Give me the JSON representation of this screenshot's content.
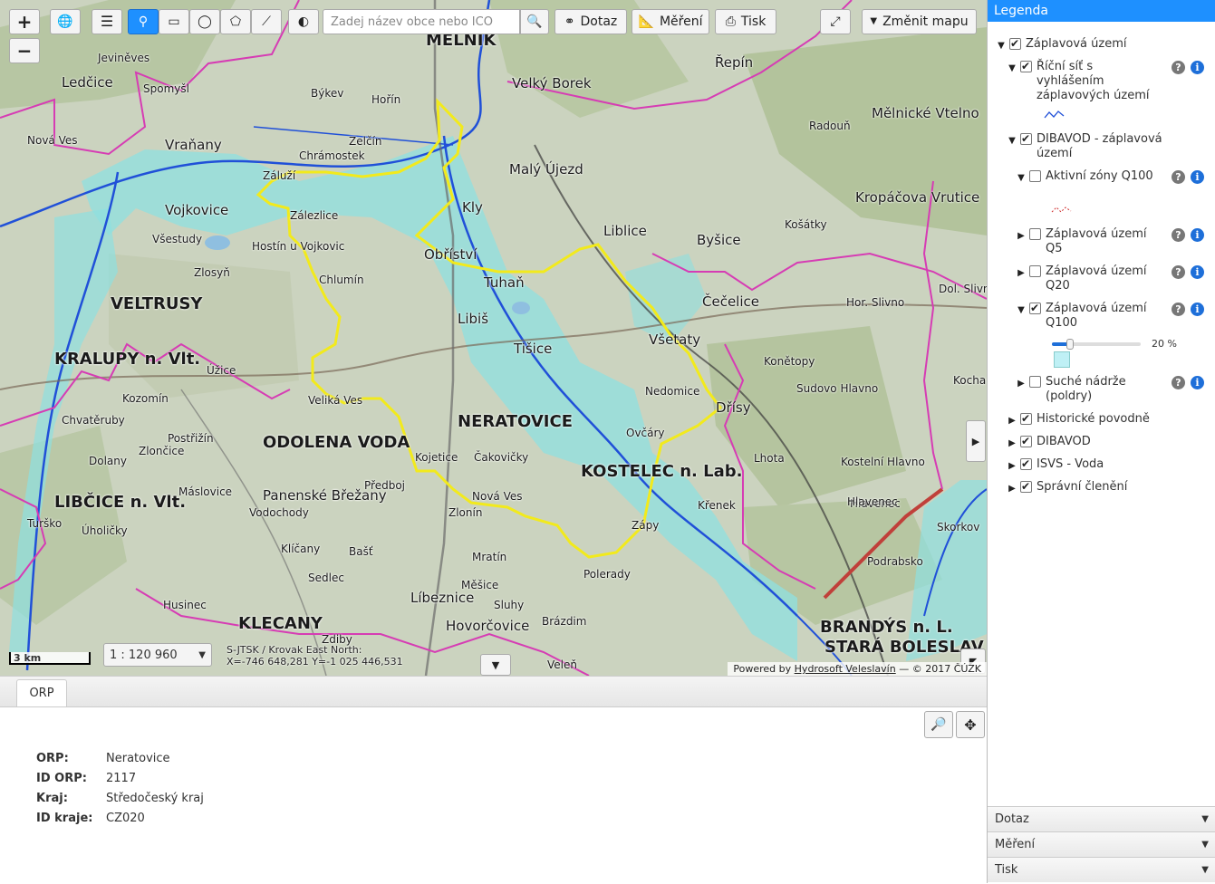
{
  "map": {
    "search_placeholder": "Zadej název obce nebo ICO",
    "toolbar": {
      "zoom_in": "+",
      "zoom_out": "−",
      "dotaz": "Dotaz",
      "mereni": "Měření",
      "tisk": "Tisk",
      "zmenit_mapu": "Změnit mapu"
    },
    "scalebar": "3 km",
    "scale": "1 : 120 960",
    "coords_line1": "S-JTSK / Krovak East North:",
    "coords_line2": "X=-746 648,281 Y=-1 025 446,531",
    "attribution_prefix": "Powered by",
    "attribution_link": "Hydrosoft Veleslavín",
    "attribution_suffix": "— © 2017 ČÚZK",
    "places": [
      {
        "t": "MĚLNÍK",
        "c": "big"
      },
      {
        "t": "Velký Borek",
        "c": "mid"
      },
      {
        "t": "Řepín",
        "c": "mid"
      },
      {
        "t": "Mělnické Vtelno",
        "c": "mid"
      },
      {
        "t": "Spomyšl",
        "c": "small"
      },
      {
        "t": "Ledčice",
        "c": "mid"
      },
      {
        "t": "Jeviněves",
        "c": "small"
      },
      {
        "t": "Býkev",
        "c": "small"
      },
      {
        "t": "Hořín",
        "c": "small"
      },
      {
        "t": "Vraňany",
        "c": "mid"
      },
      {
        "t": "Nová Ves",
        "c": "small"
      },
      {
        "t": "Zelčín",
        "c": "small"
      },
      {
        "t": "Malý Újezd",
        "c": "mid"
      },
      {
        "t": "Radouň",
        "c": "small"
      },
      {
        "t": "Chrámostek",
        "c": "small"
      },
      {
        "t": "Vojkovice",
        "c": "mid"
      },
      {
        "t": "Záluží",
        "c": "small"
      },
      {
        "t": "Zálezlice",
        "c": "small"
      },
      {
        "t": "Kly",
        "c": "mid"
      },
      {
        "t": "Liblice",
        "c": "mid"
      },
      {
        "t": "Byšice",
        "c": "mid"
      },
      {
        "t": "Kropáčova Vrutice",
        "c": "mid"
      },
      {
        "t": "Košátky",
        "c": "small"
      },
      {
        "t": "Všestudy",
        "c": "small"
      },
      {
        "t": "Hostín u Vojkovic",
        "c": "small"
      },
      {
        "t": "Obříství",
        "c": "mid"
      },
      {
        "t": "Tuhaň",
        "c": "mid"
      },
      {
        "t": "Zlosyň",
        "c": "small"
      },
      {
        "t": "Chlumín",
        "c": "small"
      },
      {
        "t": "VELTRUSY",
        "c": "big"
      },
      {
        "t": "Libiš",
        "c": "mid"
      },
      {
        "t": "Čečelice",
        "c": "mid"
      },
      {
        "t": "Hor. Slivno",
        "c": "small"
      },
      {
        "t": "Dol. Slivno",
        "c": "small"
      },
      {
        "t": "Úžice",
        "c": "small"
      },
      {
        "t": "KRALUPY n. Vlt.",
        "c": "big"
      },
      {
        "t": "Tišice",
        "c": "mid"
      },
      {
        "t": "Všetaty",
        "c": "mid"
      },
      {
        "t": "Konětopy",
        "c": "small"
      },
      {
        "t": "Kozomín",
        "c": "small"
      },
      {
        "t": "Veliká Ves",
        "c": "small"
      },
      {
        "t": "Nedomice",
        "c": "small"
      },
      {
        "t": "Sudovo Hlavno",
        "c": "small"
      },
      {
        "t": "Dřísy",
        "c": "mid"
      },
      {
        "t": "Chvatěruby",
        "c": "small"
      },
      {
        "t": "Postřižín",
        "c": "small"
      },
      {
        "t": "ODOLENA VODA",
        "c": "big"
      },
      {
        "t": "NERATOVICE",
        "c": "big"
      },
      {
        "t": "Zlončice",
        "c": "small"
      },
      {
        "t": "Kojetice",
        "c": "small"
      },
      {
        "t": "Čakovičky",
        "c": "small"
      },
      {
        "t": "Ovčáry",
        "c": "small"
      },
      {
        "t": "KOSTELEC n. Lab.",
        "c": "big"
      },
      {
        "t": "Lhota",
        "c": "small"
      },
      {
        "t": "Kostelní Hlavno",
        "c": "small"
      },
      {
        "t": "Dolany",
        "c": "small"
      },
      {
        "t": "Panenské Břežany",
        "c": "mid"
      },
      {
        "t": "Předboj",
        "c": "small"
      },
      {
        "t": "Nová Ves",
        "c": "small"
      },
      {
        "t": "Hlavenec",
        "c": "small"
      },
      {
        "t": "LIBČICE n. Vlt.",
        "c": "big"
      },
      {
        "t": "Máslovice",
        "c": "small"
      },
      {
        "t": "Vodochody",
        "c": "small"
      },
      {
        "t": "Zlonín",
        "c": "small"
      },
      {
        "t": "Křenek",
        "c": "small"
      },
      {
        "t": "Zápy",
        "c": "small"
      },
      {
        "t": "Turško",
        "c": "small"
      },
      {
        "t": "Úholičky",
        "c": "small"
      },
      {
        "t": "Klíčany",
        "c": "small"
      },
      {
        "t": "Bašť",
        "c": "small"
      },
      {
        "t": "Mratín",
        "c": "small"
      },
      {
        "t": "Podrabsko",
        "c": "small"
      },
      {
        "t": "Sedlec",
        "c": "small"
      },
      {
        "t": "Líbeznice",
        "c": "mid"
      },
      {
        "t": "Měšice",
        "c": "small"
      },
      {
        "t": "Polerady",
        "c": "small"
      },
      {
        "t": "Sluhy",
        "c": "small"
      },
      {
        "t": "Husinec",
        "c": "small"
      },
      {
        "t": "KLECANY",
        "c": "big"
      },
      {
        "t": "Hovorčovice",
        "c": "mid"
      },
      {
        "t": "Brázdim",
        "c": "small"
      },
      {
        "t": "BRANDÝS n. L.",
        "c": "big"
      },
      {
        "t": "STARÁ BOLESLAV",
        "c": "big"
      },
      {
        "t": "Veleň",
        "c": "small"
      },
      {
        "t": "Zdiby",
        "c": "small"
      },
      {
        "t": "Skorkov",
        "c": "small"
      },
      {
        "t": "Kocha",
        "c": "small"
      },
      {
        "t": "Hlavenec",
        "c": "small"
      }
    ]
  },
  "bottom": {
    "tab_label": "ORP",
    "rows": [
      {
        "key": "ORP:",
        "value": "Neratovice"
      },
      {
        "key": "ID ORP:",
        "value": "2117"
      },
      {
        "key": "Kraj:",
        "value": "Středočeský kraj"
      },
      {
        "key": "ID kraje:",
        "value": "CZ020"
      }
    ]
  },
  "sidebar": {
    "title": "Legenda",
    "tree": [
      {
        "label": "Záplavová území",
        "checked": true,
        "tri": "open"
      },
      {
        "label": "Říční síť s vyhlášením záplavových území",
        "checked": true,
        "tri": "open"
      },
      {
        "label": "DIBAVOD - záplavová území",
        "checked": true,
        "tri": "open"
      },
      {
        "label": "Aktivní zóny Q100",
        "checked": false,
        "tri": "open"
      },
      {
        "label": "Záplavová území Q5",
        "checked": false,
        "tri": "closed"
      },
      {
        "label": "Záplavová území Q20",
        "checked": false,
        "tri": "closed"
      },
      {
        "label": "Záplavová území Q100",
        "checked": true,
        "tri": "open"
      },
      {
        "label": "Suché nádrže (poldry)",
        "checked": false,
        "tri": "closed"
      },
      {
        "label": "Historické povodně",
        "checked": true,
        "tri": "closed"
      },
      {
        "label": "DIBAVOD",
        "checked": true,
        "tri": "closed"
      },
      {
        "label": "ISVS - Voda",
        "checked": true,
        "tri": "closed"
      },
      {
        "label": "Správní členění",
        "checked": true,
        "tri": "closed"
      }
    ],
    "opacity_label": "20 %",
    "opacity_value": 0.2,
    "accordions": [
      "Dotaz",
      "Měření",
      "Tisk"
    ]
  }
}
